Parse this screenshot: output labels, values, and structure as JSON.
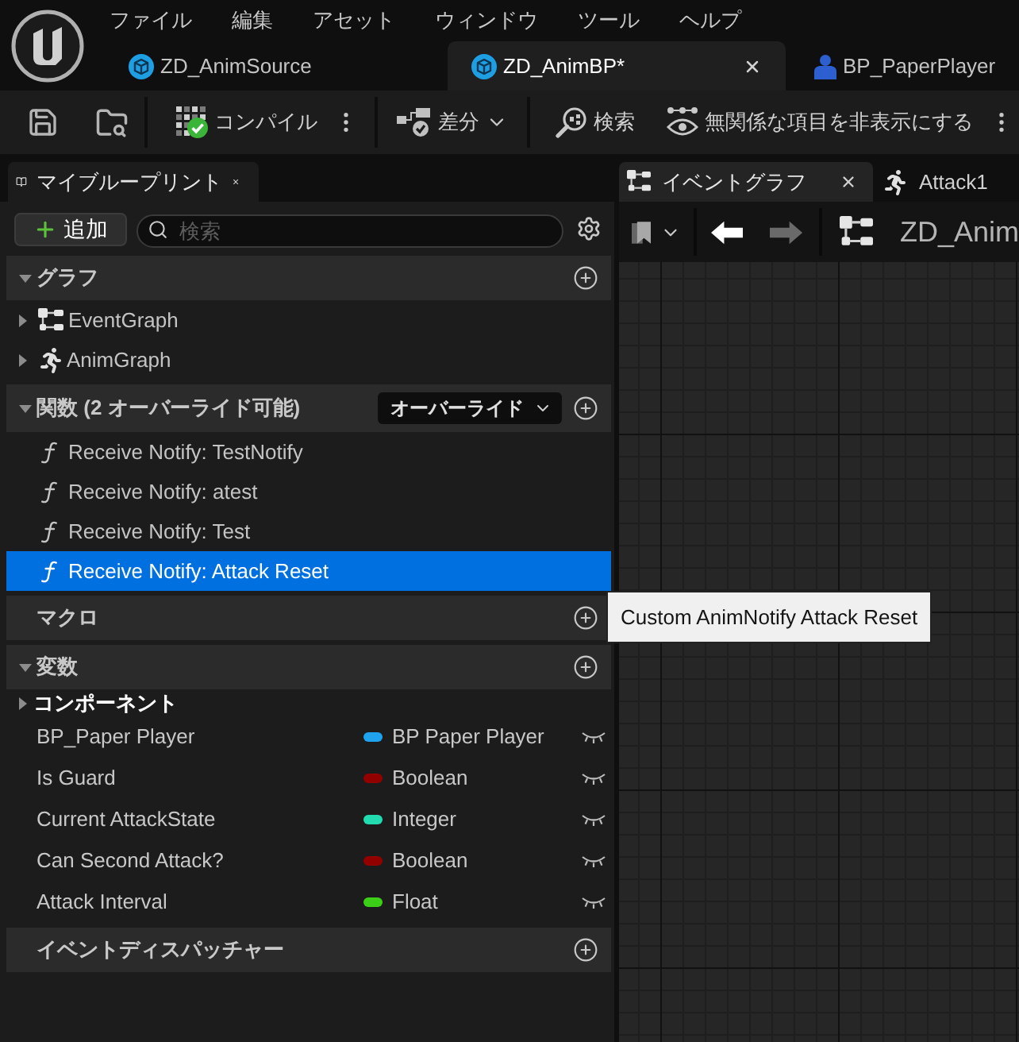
{
  "menu": [
    "ファイル",
    "編集",
    "アセット",
    "ウィンドウ",
    "ツール",
    "ヘルプ"
  ],
  "document_tabs": [
    {
      "label": "ZD_AnimSource",
      "kind": "asset",
      "selected": false
    },
    {
      "label": "ZD_AnimBP*",
      "kind": "asset",
      "selected": true
    },
    {
      "label": "BP_PaperPlayer",
      "kind": "blueprint",
      "selected": false
    }
  ],
  "toolbar": [
    {
      "kind": "save"
    },
    {
      "kind": "browse"
    },
    {
      "kind": "compile",
      "label": "コンパイル"
    },
    {
      "kind": "diff",
      "label": "差分"
    },
    {
      "kind": "search",
      "label": "検索"
    },
    {
      "kind": "hide_unrelated",
      "label": "無関係な項目を非表示にする"
    }
  ],
  "my_blueprint": {
    "tab": "マイブループリント",
    "add_button": "追加",
    "search": {
      "placeholder": "検索"
    },
    "sections": [
      {
        "title": "グラフ",
        "expanded": true,
        "items": [
          {
            "label": "EventGraph",
            "kind": "event_graph",
            "expanded": false,
            "selected": false
          },
          {
            "label": "AnimGraph",
            "kind": "anim_graph",
            "expanded": false,
            "selected": false
          }
        ]
      },
      {
        "title": "関数 (2 オーバーライド可能)",
        "expanded": true,
        "override_button": "オーバーライド",
        "items": [
          {
            "label": "Receive Notify: TestNotify",
            "kind": "function",
            "selected": false
          },
          {
            "label": "Receive Notify: atest",
            "kind": "function",
            "selected": false
          },
          {
            "label": "Receive Notify: Test",
            "kind": "function",
            "selected": false
          },
          {
            "label": "Receive Notify: Attack Reset",
            "kind": "function",
            "selected": true
          }
        ]
      },
      {
        "title": "マクロ"
      },
      {
        "title": "変数",
        "expanded": true,
        "categories": [
          {
            "label": "コンポーネント",
            "expanded": false
          }
        ],
        "variables": [
          {
            "name": "BP_Paper Player",
            "type": "BP Paper Player",
            "color": "#1fa3ee",
            "public": false
          },
          {
            "name": "Is Guard",
            "type": "Boolean",
            "color": "#930000",
            "public": false
          },
          {
            "name": "Current AttackState",
            "type": "Integer",
            "color": "#22dbb0",
            "public": false
          },
          {
            "name": "Can Second Attack?",
            "type": "Boolean",
            "color": "#930000",
            "public": false
          },
          {
            "name": "Attack Interval",
            "type": "Float",
            "color": "#3ccf18",
            "public": false
          }
        ]
      },
      {
        "title": "イベントディスパッチャー"
      }
    ]
  },
  "tooltip": "Custom AnimNotify Attack Reset",
  "graph_tabs": [
    {
      "label": "イベントグラフ",
      "kind": "event_graph",
      "selected": true
    },
    {
      "label": "Attack1",
      "kind": "anim_graph",
      "selected": false
    }
  ],
  "graph_toolbar": {
    "back_enabled": true,
    "forward_enabled": false,
    "breadcrumb": "ZD_Anim"
  }
}
